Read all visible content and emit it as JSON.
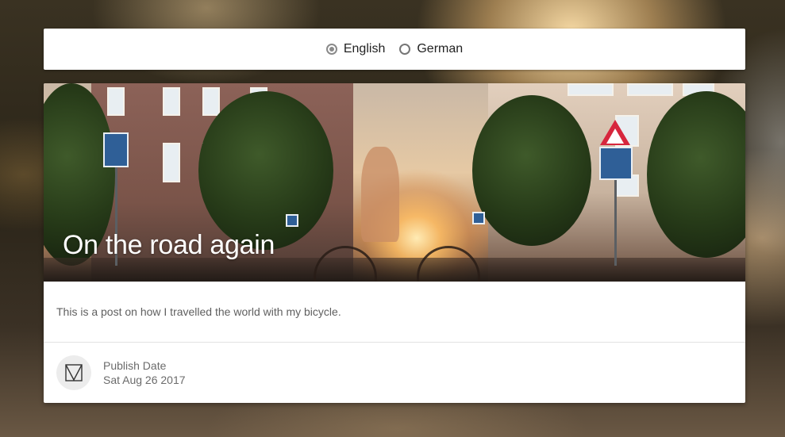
{
  "language_selector": {
    "options": [
      {
        "label": "English",
        "selected": true
      },
      {
        "label": "German",
        "selected": false
      }
    ]
  },
  "post": {
    "title": "On the road again",
    "description": "This is a post on how I travelled the world with my bicycle.",
    "publish_date_label": "Publish Date",
    "publish_date_value": "Sat Aug 26 2017",
    "image_alt": "cyclist riding through a city street at sunset",
    "avatar_icon": "book-icon"
  }
}
